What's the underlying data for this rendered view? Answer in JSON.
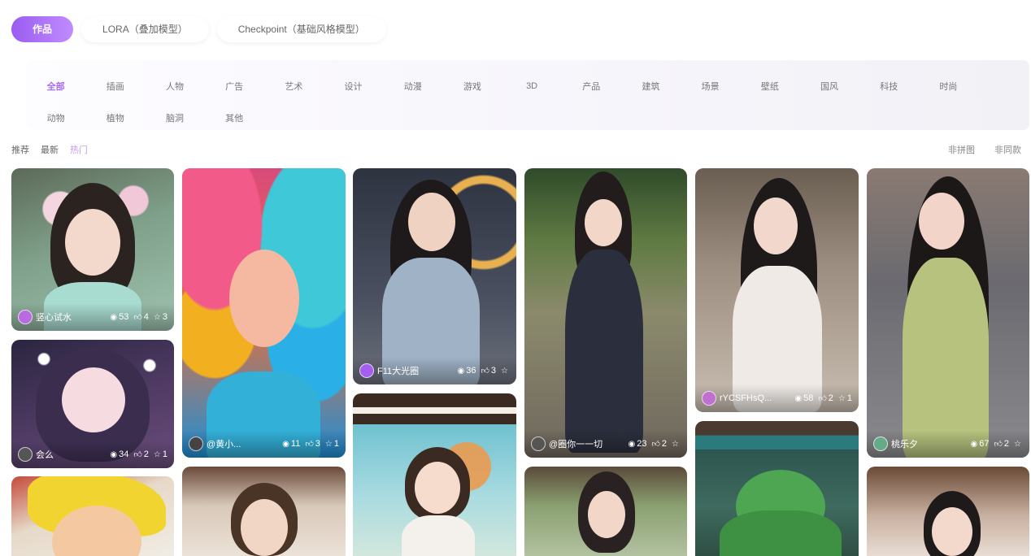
{
  "top_tabs": [
    {
      "label": "作品",
      "active": true
    },
    {
      "label": "LORA（叠加模型）",
      "active": false
    },
    {
      "label": "Checkpoint（基础风格模型）",
      "active": false
    }
  ],
  "categories_row1": [
    "全部",
    "插画",
    "人物",
    "广告",
    "艺术",
    "设计",
    "动漫",
    "游戏",
    "3D",
    "产品",
    "建筑",
    "场景",
    "壁纸",
    "国风",
    "科技",
    "时尚"
  ],
  "categories_row2": [
    "动物",
    "植物",
    "脑洞",
    "其他"
  ],
  "active_category": "全部",
  "sort": [
    "推荐",
    "最新",
    "热门"
  ],
  "active_sort": "热门",
  "filters": [
    "非拼图",
    "非同款"
  ],
  "cards": [
    {
      "author": "竖心试水",
      "views": "53",
      "likes": "4",
      "stars": "3",
      "avatar_color": "#b86be0"
    },
    {
      "author": "会么",
      "views": "34",
      "likes": "2",
      "stars": "1",
      "avatar_color": "#555"
    },
    {
      "author": "",
      "views": "",
      "likes": "",
      "stars": "",
      "avatar_color": "#333"
    },
    {
      "author": "@黄小...",
      "views": "11",
      "likes": "3",
      "stars": "1",
      "avatar_color": "#444"
    },
    {
      "author": "",
      "views": "",
      "likes": "",
      "stars": "",
      "avatar_color": "#999"
    },
    {
      "author": "F11大光圈",
      "views": "36",
      "likes": "3",
      "stars": "",
      "avatar_color": "#a45ef0"
    },
    {
      "author": "",
      "views": "",
      "likes": "",
      "stars": "",
      "avatar_color": "#999"
    },
    {
      "author": "@圈你一一切",
      "views": "23",
      "likes": "2",
      "stars": "",
      "avatar_color": "#555"
    },
    {
      "author": "",
      "views": "",
      "likes": "",
      "stars": "",
      "avatar_color": "#999"
    },
    {
      "author": "rYCSFHsQ...",
      "views": "58",
      "likes": "2",
      "stars": "1",
      "avatar_color": "#c070d0"
    },
    {
      "author": "",
      "views": "",
      "likes": "",
      "stars": "",
      "avatar_color": "#999"
    },
    {
      "author": "桃乐夕",
      "views": "67",
      "likes": "2",
      "stars": "",
      "avatar_color": "#6a8"
    },
    {
      "author": "",
      "views": "",
      "likes": "",
      "stars": "",
      "avatar_color": "#999"
    }
  ],
  "icons": {
    "views": "eye-icon",
    "likes": "thumbs-up-icon",
    "stars": "star-icon"
  },
  "colors": {
    "accent": "#a86ef2",
    "tab_gradient_start": "#9a5cf0",
    "tab_gradient_end": "#c08cff"
  }
}
